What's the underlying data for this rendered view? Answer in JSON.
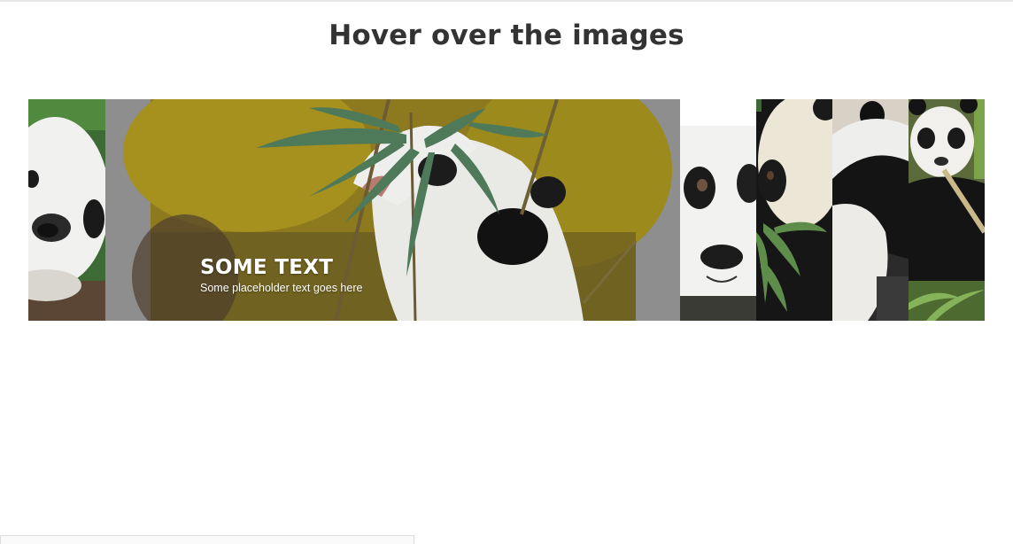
{
  "page": {
    "title": "Hover over the images"
  },
  "gallery": {
    "active_index": 1,
    "frame_color": "#8e8e8e",
    "panels": [
      {
        "index": 1,
        "state": "collapsed"
      },
      {
        "index": 2,
        "state": "expanded",
        "caption_title": "SOME TEXT",
        "caption_text": "Some placeholder text goes here"
      },
      {
        "index": 3,
        "state": "collapsed"
      },
      {
        "index": 4,
        "state": "collapsed"
      },
      {
        "index": 5,
        "state": "collapsed"
      },
      {
        "index": 6,
        "state": "collapsed"
      }
    ]
  }
}
